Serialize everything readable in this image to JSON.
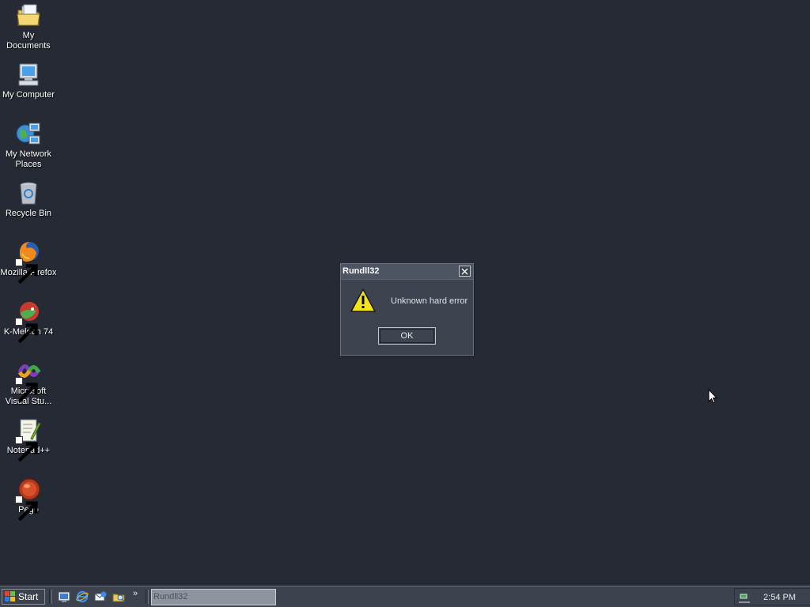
{
  "desktop": {
    "background": "#252a34",
    "icons": [
      {
        "label": "My Documents",
        "icon": "folder-documents-icon"
      },
      {
        "label": "My Computer",
        "icon": "computer-icon"
      },
      {
        "label": "My Network Places",
        "icon": "network-places-icon"
      },
      {
        "label": "Recycle Bin",
        "icon": "recycle-bin-icon"
      },
      {
        "label": "Mozilla Firefox",
        "icon": "firefox-icon"
      },
      {
        "label": "K-Meleon 74",
        "icon": "k-meleon-icon"
      },
      {
        "label": "Microsoft Visual Stu...",
        "icon": "visual-studio-icon"
      },
      {
        "label": "Notepad++",
        "icon": "notepad-plus-plus-icon"
      },
      {
        "label": "Pego",
        "icon": "pego-icon"
      }
    ]
  },
  "dialog": {
    "title": "Rundll32",
    "message": "Unknown hard error",
    "ok_label": "OK",
    "icon": "warning-icon"
  },
  "taskbar": {
    "start_label": "Start",
    "quick_launch": [
      "show-desktop-icon",
      "internet-explorer-icon",
      "outlook-express-icon",
      "windows-explorer-icon"
    ],
    "overflow": "»",
    "task_label": "Rundll32",
    "clock": "2:54 PM",
    "tray_icon": "network-tray-icon"
  }
}
